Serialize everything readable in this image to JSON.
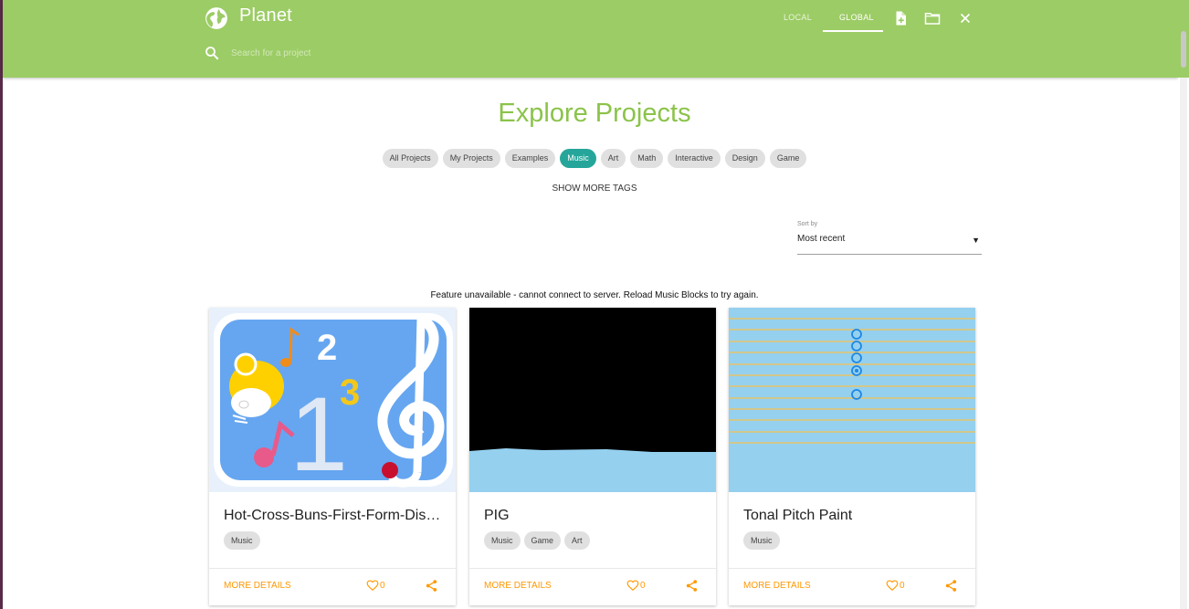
{
  "header": {
    "app_title": "Planet",
    "tabs": [
      {
        "label": "LOCAL",
        "active": false
      },
      {
        "label": "GLOBAL",
        "active": true
      }
    ],
    "icons": [
      "new-file-icon",
      "open-folder-icon",
      "close-icon"
    ],
    "search_placeholder": "Search for a project"
  },
  "main": {
    "heading": "Explore Projects",
    "tags": [
      "All Projects",
      "My Projects",
      "Examples",
      "Music",
      "Art",
      "Math",
      "Interactive",
      "Design",
      "Game"
    ],
    "active_tag": "Music",
    "show_more_tags": "SHOW MORE TAGS",
    "sort": {
      "label": "Sort by",
      "value": "Most recent"
    },
    "notice": "Feature unavailable - cannot connect to server. Reload Music Blocks to try again."
  },
  "projects": [
    {
      "title": "Hot-Cross-Buns-First-Form-Discovery",
      "tags": [
        "Music"
      ],
      "more": "MORE DETAILS",
      "likes": "0"
    },
    {
      "title": "PIG",
      "tags": [
        "Music",
        "Game",
        "Art"
      ],
      "more": "MORE DETAILS",
      "likes": "0"
    },
    {
      "title": "Tonal Pitch Paint",
      "tags": [
        "Music"
      ],
      "more": "MORE DETAILS",
      "likes": "0"
    }
  ],
  "colors": {
    "header": "#9ccc65",
    "heading": "#8bc34a",
    "active_chip": "#26a69a",
    "accent": "#ff9800"
  }
}
